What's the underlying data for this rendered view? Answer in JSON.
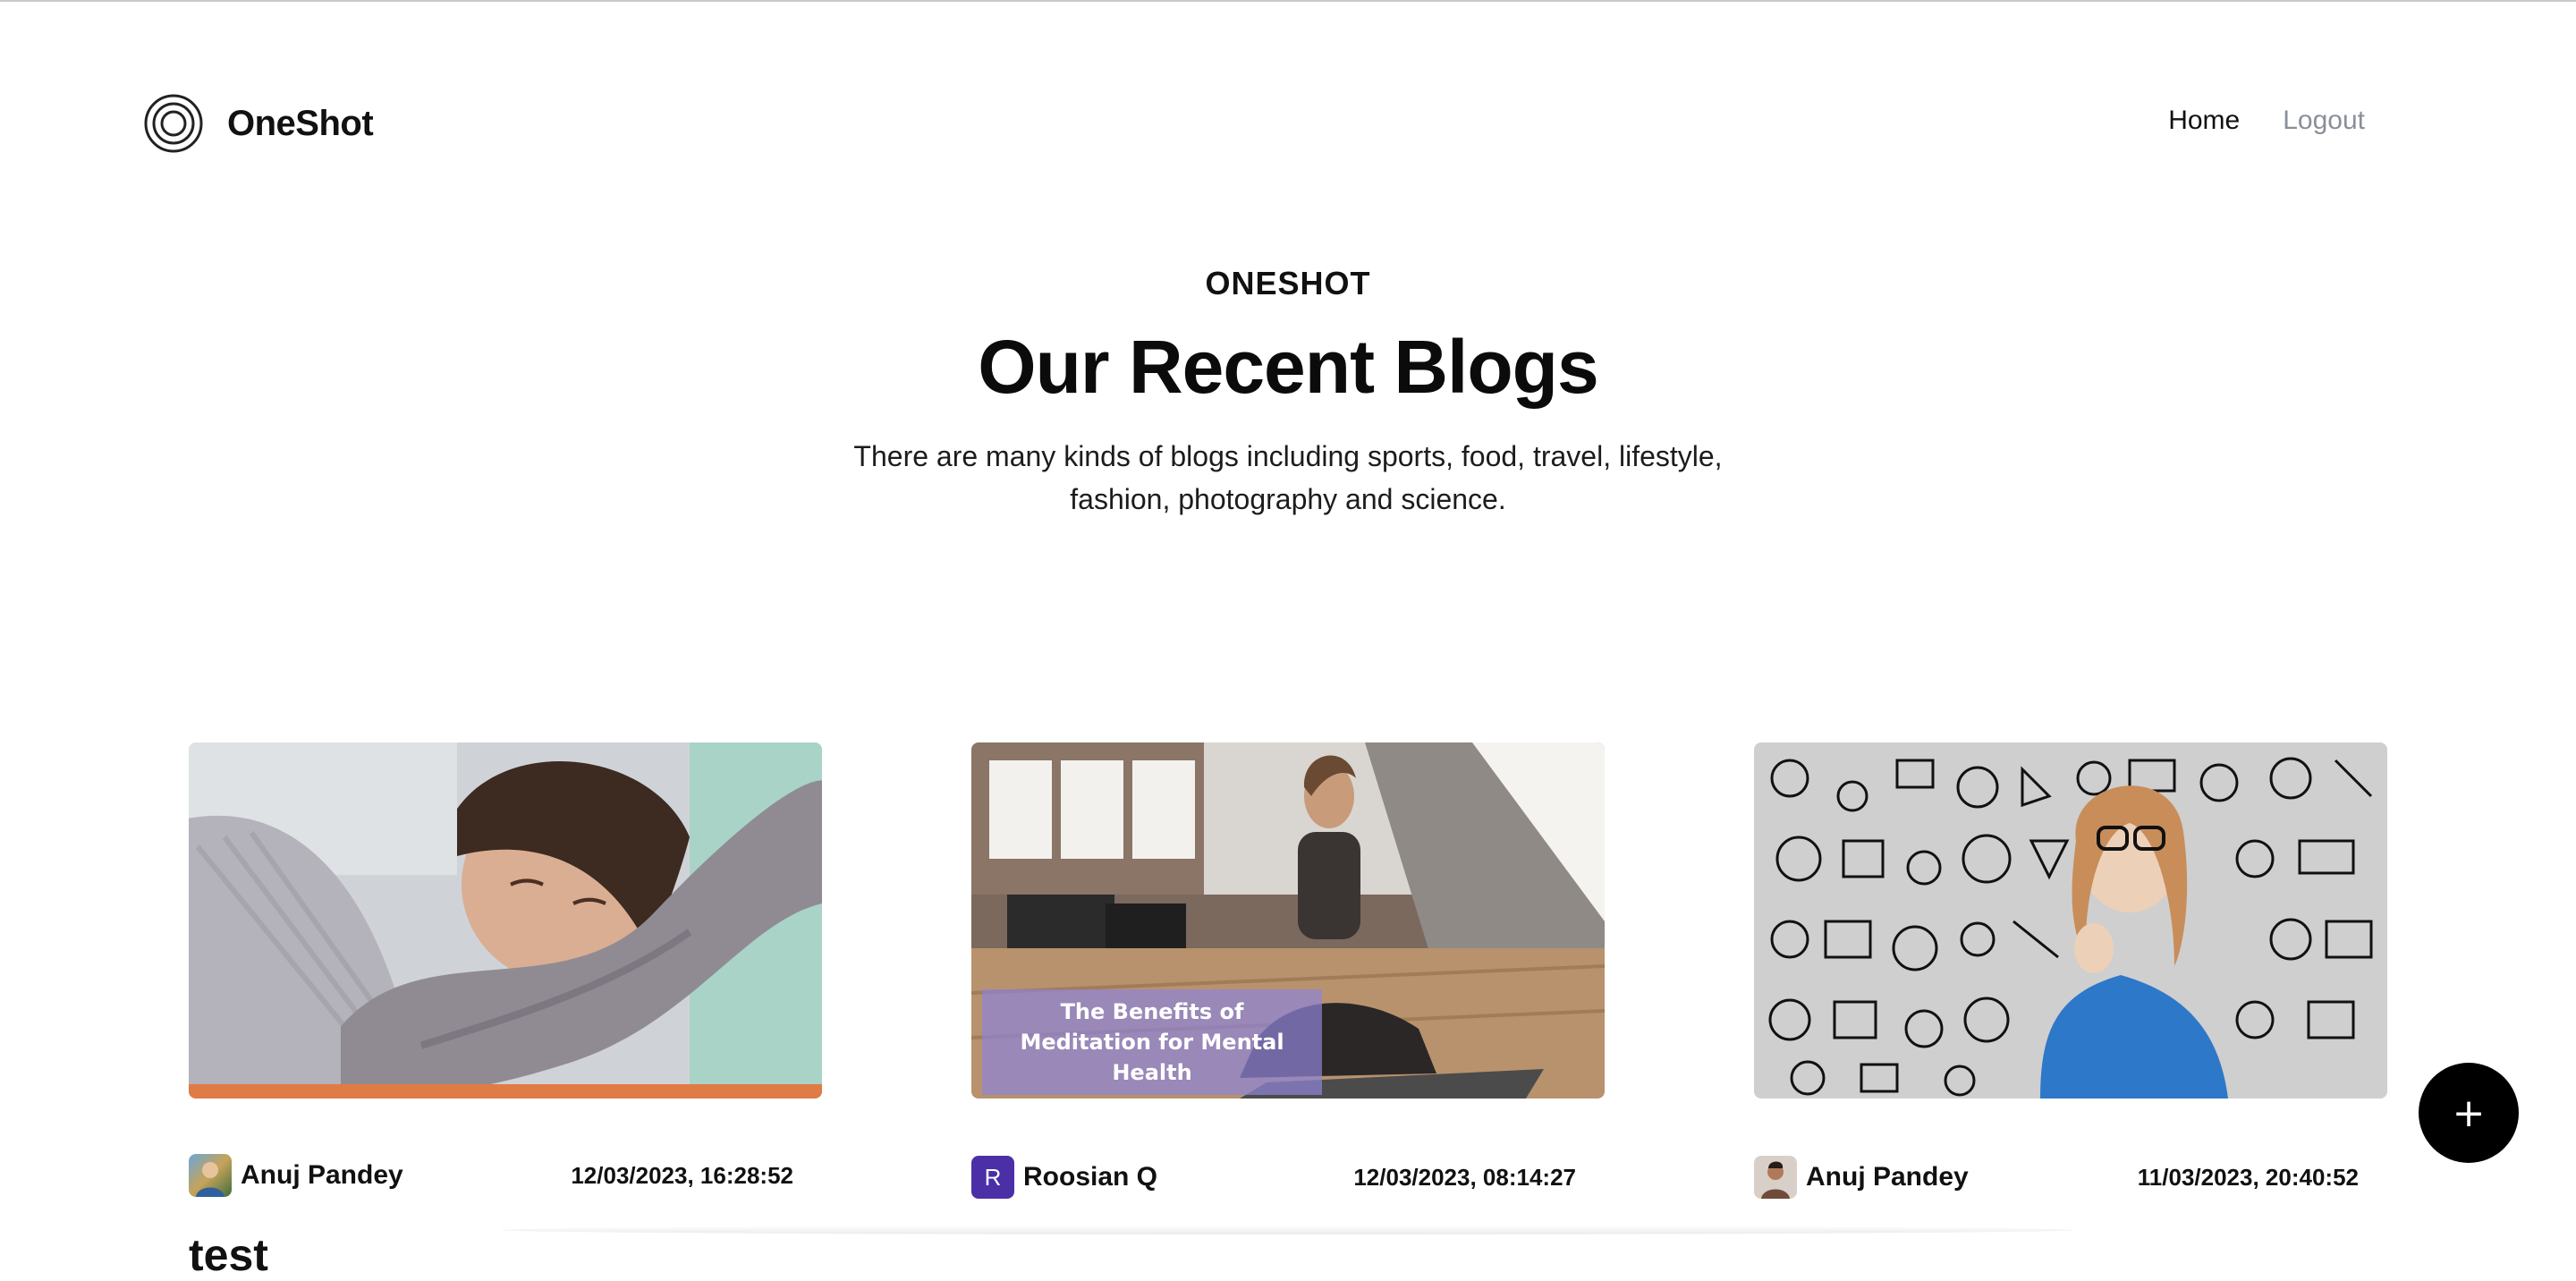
{
  "brand": {
    "name": "OneShot",
    "logo_icon": "concentric-circles-icon"
  },
  "nav": {
    "home": "Home",
    "logout": "Logout"
  },
  "hero": {
    "eyebrow": "ONESHOT",
    "title": "Our Recent Blogs",
    "subtitle": "There are many kinds of blogs including sports, food, travel, lifestyle, fashion, photography and science."
  },
  "posts": [
    {
      "author": "Anuj Pandey",
      "date": "12/03/2023, 16:28:52",
      "title": "test",
      "image": "sleeping-woman-photo",
      "avatar_icon": "avatar-photo"
    },
    {
      "author": "Roosian Q",
      "avatar_letter": "R",
      "avatar_color": "#4b2fa6",
      "date": "12/03/2023, 08:14:27",
      "image": "meditation-photo",
      "image_caption": "The Benefits of Meditation for Mental Health"
    },
    {
      "author": "Anuj Pandey",
      "date": "11/03/2023, 20:40:52",
      "image": "thinking-woman-doodles-photo",
      "avatar_icon": "avatar-photo"
    }
  ],
  "fab": {
    "label": "+",
    "icon": "plus-icon"
  }
}
